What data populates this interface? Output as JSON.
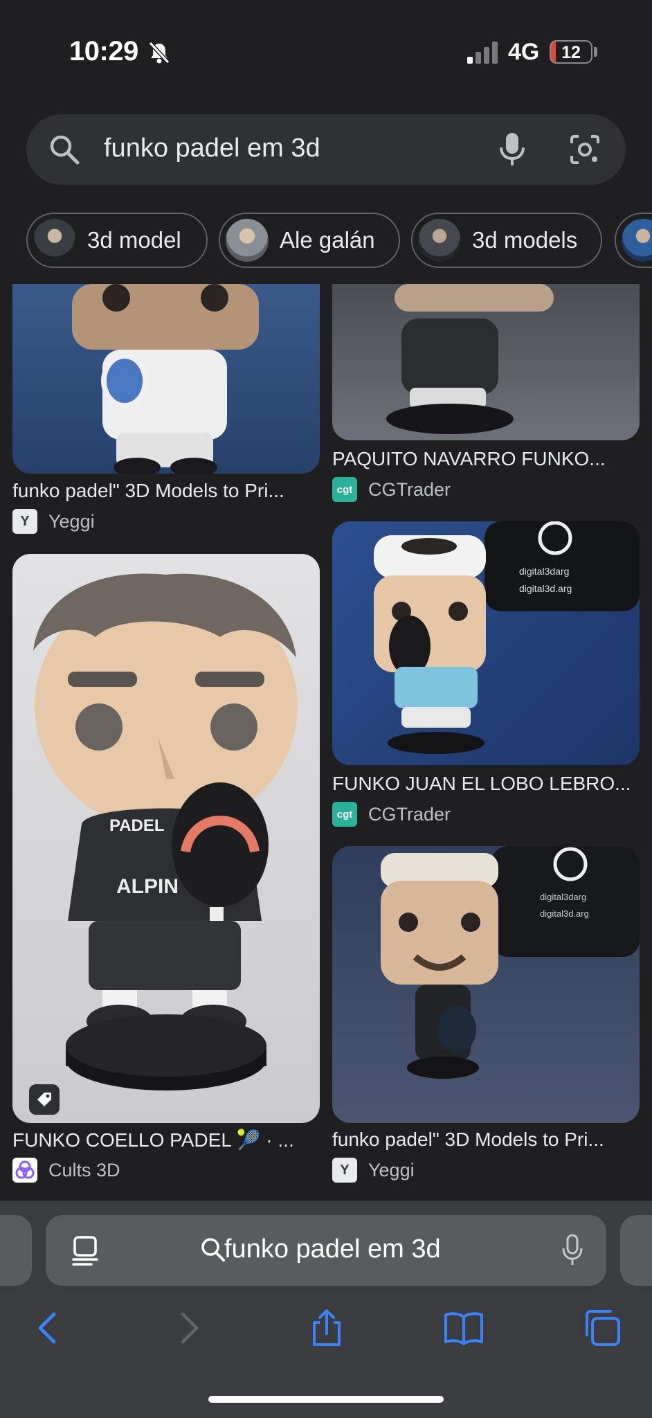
{
  "status": {
    "time": "10:29",
    "network": "4G",
    "battery": "12",
    "battery_level": 0.12
  },
  "search": {
    "query": "funko padel em 3d"
  },
  "chips": [
    {
      "label": "3d model"
    },
    {
      "label": "Ale galán"
    },
    {
      "label": "3d models"
    }
  ],
  "results": [
    {
      "title": "funko padel\" 3D Models to Pri...",
      "source": "Yeggi",
      "favicon": "Y"
    },
    {
      "title": "PAQUITO NAVARRO FUNKO...",
      "source": "CGTrader",
      "favicon": "cgt"
    },
    {
      "title": "FUNKO COELLO PADEL 🎾 · ...",
      "source": "Cults 3D",
      "favicon": "cults-icon"
    },
    {
      "title": "FUNKO JUAN EL LOBO LEBRO...",
      "source": "CGTrader",
      "favicon": "cgt"
    },
    {
      "title": "funko padel\" 3D Models to Pri...",
      "source": "Yeggi",
      "favicon": "Y"
    }
  ],
  "address_bar": {
    "text": "funko padel em 3d"
  },
  "colors": {
    "background": "#1f1f21",
    "accent": "#3b82f6",
    "cgt": "#2bb09a"
  }
}
